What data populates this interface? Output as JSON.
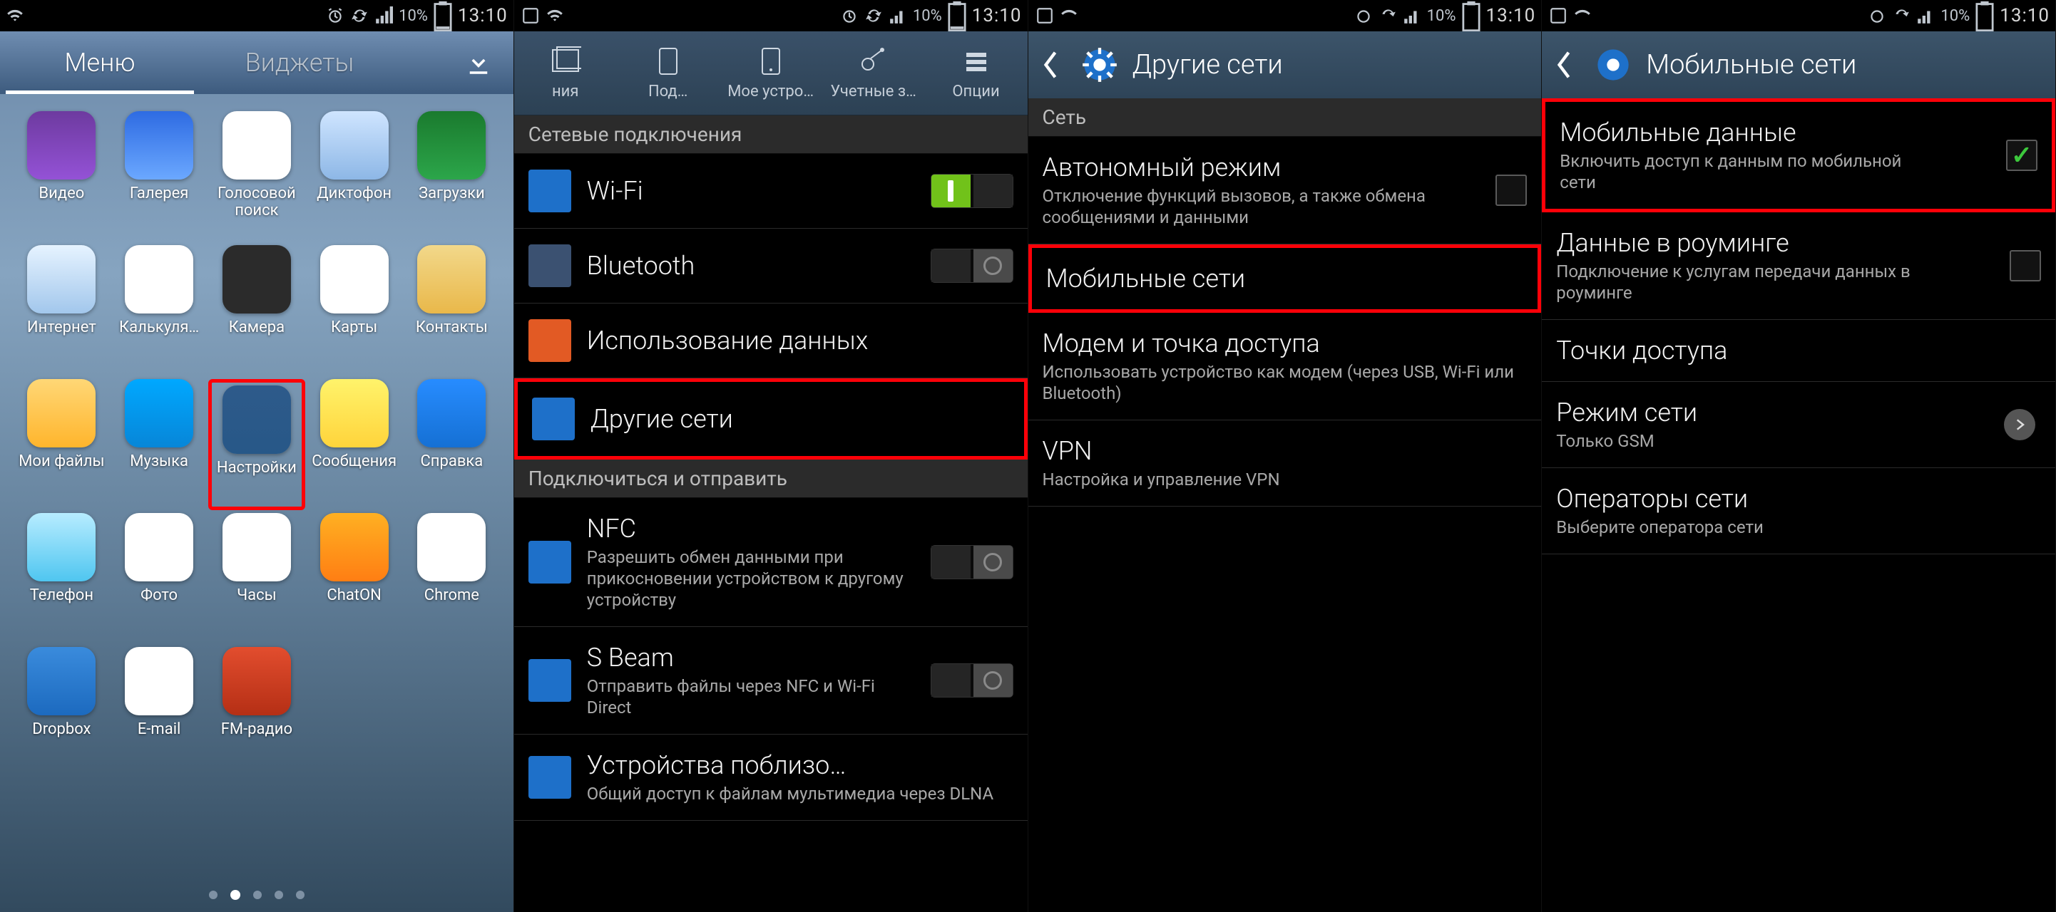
{
  "status": {
    "battery": "10%",
    "clock": "13:10"
  },
  "screen1": {
    "tab_menu": "Меню",
    "tab_widgets": "Виджеты",
    "apps": [
      {
        "label": "Видео",
        "cls": "c-video"
      },
      {
        "label": "Галерея",
        "cls": "c-gal"
      },
      {
        "label": "Голосовой поиск",
        "cls": "c-voice"
      },
      {
        "label": "Диктофон",
        "cls": "c-rec"
      },
      {
        "label": "Загрузки",
        "cls": "c-dl"
      },
      {
        "label": "Интернет",
        "cls": "c-www"
      },
      {
        "label": "Калькуля…",
        "cls": "c-calc"
      },
      {
        "label": "Камера",
        "cls": "c-cam"
      },
      {
        "label": "Карты",
        "cls": "c-maps"
      },
      {
        "label": "Контакты",
        "cls": "c-cont"
      },
      {
        "label": "Мои файлы",
        "cls": "c-files"
      },
      {
        "label": "Музыка",
        "cls": "c-music"
      },
      {
        "label": "Настройки",
        "cls": "c-set",
        "hl": true
      },
      {
        "label": "Сообщения",
        "cls": "c-msg"
      },
      {
        "label": "Справка",
        "cls": "c-help"
      },
      {
        "label": "Телефон",
        "cls": "c-phone"
      },
      {
        "label": "Фото",
        "cls": "c-photo"
      },
      {
        "label": "Часы",
        "cls": "c-clock"
      },
      {
        "label": "ChatON",
        "cls": "c-chaton"
      },
      {
        "label": "Chrome",
        "cls": "c-chrome"
      },
      {
        "label": "Dropbox",
        "cls": "c-dropbox"
      },
      {
        "label": "E-mail",
        "cls": "c-mail"
      },
      {
        "label": "FM-радио",
        "cls": "c-fm"
      }
    ]
  },
  "screen2": {
    "tabs": [
      "ния",
      "Под…",
      "Мое устро…",
      "Учетные з…",
      "Опции"
    ],
    "section_net": "Сетевые подключения",
    "items_net": [
      {
        "title": "Wi-Fi",
        "toggle": "on",
        "iconCls": "ri-wifi"
      },
      {
        "title": "Bluetooth",
        "toggle": "off",
        "iconCls": "ri-bt"
      },
      {
        "title": "Использование данных",
        "iconCls": "ri-data"
      },
      {
        "title": "Другие сети",
        "iconCls": "ri-other",
        "hl": true
      }
    ],
    "section_share": "Подключиться и отправить",
    "items_share": [
      {
        "title": "NFC",
        "sub": "Разрешить обмен данными при прикосновении устройством к другому устройству",
        "toggle": "off",
        "iconCls": "ri-nfc"
      },
      {
        "title": "S Beam",
        "sub": "Отправить файлы через NFC и Wi-Fi Direct",
        "toggle": "off",
        "iconCls": "ri-sbeam"
      },
      {
        "title": "Устройства поблизо…",
        "sub": "Общий доступ к файлам мультимедиа через DLNA",
        "iconCls": "ri-nearby"
      }
    ]
  },
  "screen3": {
    "title": "Другие сети",
    "section": "Сеть",
    "items": [
      {
        "title": "Автономный режим",
        "sub": "Отключение функций вызовов, а также обмена сообщениями и данными",
        "checkbox": "off"
      },
      {
        "title": "Мобильные сети",
        "hl": true
      },
      {
        "title": "Модем и точка доступа",
        "sub": "Использовать устройство как модем (через USB, Wi-Fi или Bluetooth)"
      },
      {
        "title": "VPN",
        "sub": "Настройка и управление VPN"
      }
    ]
  },
  "screen4": {
    "title": "Мобильные сети",
    "items": [
      {
        "title": "Мобильные данные",
        "sub": "Включить доступ к данным по мобильной сети",
        "checkbox": "on",
        "hl": true
      },
      {
        "title": "Данные в роуминге",
        "sub": "Подключение к услугам передачи данных в роуминге",
        "checkbox": "off"
      },
      {
        "title": "Точки доступа"
      },
      {
        "title": "Режим сети",
        "sub": "Только GSM",
        "chevron": true
      },
      {
        "title": "Операторы сети",
        "sub": "Выберите оператора сети"
      }
    ]
  }
}
